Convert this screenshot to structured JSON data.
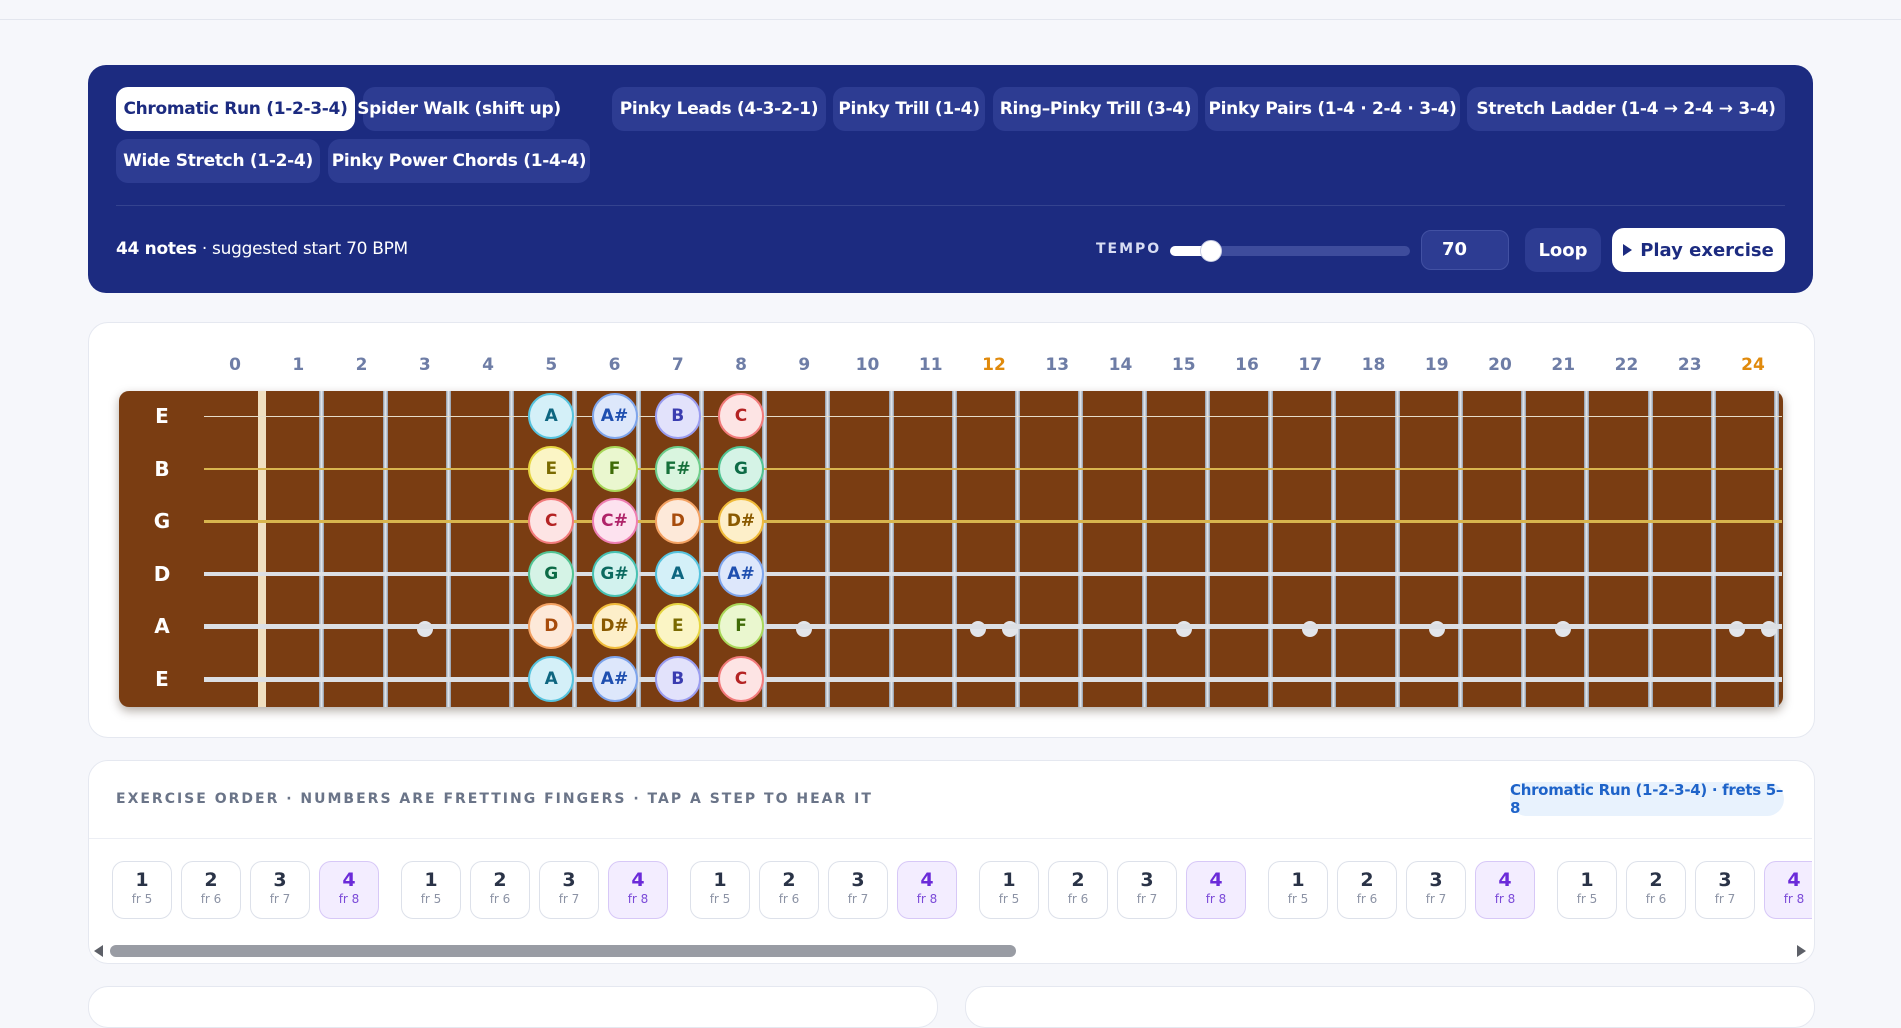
{
  "exercise_tabs": [
    {
      "label": "Chromatic Run (1-2-3-4)",
      "active": true
    },
    {
      "label": "Spider Walk (shift up)",
      "active": false
    },
    {
      "label": "Pinky Leads (4-3-2-1)",
      "active": false
    },
    {
      "label": "Pinky Trill (1-4)",
      "active": false
    },
    {
      "label": "Ring–Pinky Trill (3-4)",
      "active": false
    },
    {
      "label": "Pinky Pairs (1-4 · 2-4 · 3-4)",
      "active": false
    },
    {
      "label": "Stretch Ladder (1-4 → 2-4 → 3-4)",
      "active": false
    },
    {
      "label": "Wide Stretch (1-2-4)",
      "active": false
    },
    {
      "label": "Pinky Power Chords (1-4-4)",
      "active": false
    }
  ],
  "controls": {
    "note_count": "44 notes",
    "suggested": "· suggested start 70 BPM",
    "tempo_label": "TEMPO",
    "tempo_value": "70",
    "tempo_slider_fraction": 0.17,
    "loop_label": "Loop",
    "play_label": "Play exercise",
    "play_icon": "play-icon"
  },
  "fretboard": {
    "fret_numbers": [
      "0",
      "1",
      "2",
      "3",
      "4",
      "5",
      "6",
      "7",
      "8",
      "9",
      "10",
      "11",
      "12",
      "13",
      "14",
      "15",
      "16",
      "17",
      "18",
      "19",
      "20",
      "21",
      "22",
      "23",
      "24"
    ],
    "marker_frets": [
      "12",
      "24"
    ],
    "strings": [
      "E",
      "B",
      "G",
      "D",
      "A",
      "E"
    ],
    "inlay_frets": [
      "3",
      "5",
      "7",
      "9",
      "12",
      "15",
      "17",
      "19",
      "21",
      "24"
    ],
    "notes": [
      {
        "string": 0,
        "fret": 5,
        "name": "A"
      },
      {
        "string": 0,
        "fret": 6,
        "name": "A#"
      },
      {
        "string": 0,
        "fret": 7,
        "name": "B"
      },
      {
        "string": 0,
        "fret": 8,
        "name": "C"
      },
      {
        "string": 1,
        "fret": 5,
        "name": "E"
      },
      {
        "string": 1,
        "fret": 6,
        "name": "F"
      },
      {
        "string": 1,
        "fret": 7,
        "name": "F#"
      },
      {
        "string": 1,
        "fret": 8,
        "name": "G"
      },
      {
        "string": 2,
        "fret": 5,
        "name": "C"
      },
      {
        "string": 2,
        "fret": 6,
        "name": "C#"
      },
      {
        "string": 2,
        "fret": 7,
        "name": "D"
      },
      {
        "string": 2,
        "fret": 8,
        "name": "D#"
      },
      {
        "string": 3,
        "fret": 5,
        "name": "G"
      },
      {
        "string": 3,
        "fret": 6,
        "name": "G#"
      },
      {
        "string": 3,
        "fret": 7,
        "name": "A"
      },
      {
        "string": 3,
        "fret": 8,
        "name": "A#"
      },
      {
        "string": 4,
        "fret": 5,
        "name": "D"
      },
      {
        "string": 4,
        "fret": 6,
        "name": "D#"
      },
      {
        "string": 4,
        "fret": 7,
        "name": "E"
      },
      {
        "string": 4,
        "fret": 8,
        "name": "F"
      },
      {
        "string": 5,
        "fret": 5,
        "name": "A"
      },
      {
        "string": 5,
        "fret": 6,
        "name": "A#"
      },
      {
        "string": 5,
        "fret": 7,
        "name": "B"
      },
      {
        "string": 5,
        "fret": 8,
        "name": "C"
      }
    ],
    "note_colors": {
      "C": {
        "bg": "#fde4e4",
        "border": "#f27b7b",
        "text": "#b42323"
      },
      "C#": {
        "bg": "#fde2ef",
        "border": "#ee7fb2",
        "text": "#b0246a"
      },
      "D": {
        "bg": "#fde9d9",
        "border": "#f4a263",
        "text": "#a84c0c"
      },
      "D#": {
        "bg": "#fdefc9",
        "border": "#f0bb3a",
        "text": "#8a5a00"
      },
      "E": {
        "bg": "#fbf5c5",
        "border": "#e6d541",
        "text": "#7a6a00"
      },
      "F": {
        "bg": "#eaf7cf",
        "border": "#a9d85a",
        "text": "#3f6b07"
      },
      "F#": {
        "bg": "#d9f5df",
        "border": "#6dcd8a",
        "text": "#16703a"
      },
      "G": {
        "bg": "#d5f3e6",
        "border": "#52c493",
        "text": "#0d6b46"
      },
      "G#": {
        "bg": "#d2f2ee",
        "border": "#47c2b2",
        "text": "#0c6a60"
      },
      "A": {
        "bg": "#d4f0f8",
        "border": "#56c3de",
        "text": "#0e6680"
      },
      "A#": {
        "bg": "#dde7fb",
        "border": "#7ea5ec",
        "text": "#1f4fb0"
      },
      "B": {
        "bg": "#e2e2fb",
        "border": "#9a9cf0",
        "text": "#3a3cb0"
      }
    }
  },
  "exercise_order": {
    "title": "EXERCISE ORDER · NUMBERS ARE FRETTING FINGERS · TAP A STEP TO HEAR IT",
    "badge": "Chromatic Run (1-2-3-4) · frets 5–8",
    "steps": [
      {
        "finger": "1",
        "fret": "fr 5"
      },
      {
        "finger": "2",
        "fret": "fr 6"
      },
      {
        "finger": "3",
        "fret": "fr 7"
      },
      {
        "finger": "4",
        "fret": "fr 8"
      },
      {
        "finger": "1",
        "fret": "fr 5"
      },
      {
        "finger": "2",
        "fret": "fr 6"
      },
      {
        "finger": "3",
        "fret": "fr 7"
      },
      {
        "finger": "4",
        "fret": "fr 8"
      },
      {
        "finger": "1",
        "fret": "fr 5"
      },
      {
        "finger": "2",
        "fret": "fr 6"
      },
      {
        "finger": "3",
        "fret": "fr 7"
      },
      {
        "finger": "4",
        "fret": "fr 8"
      },
      {
        "finger": "1",
        "fret": "fr 5"
      },
      {
        "finger": "2",
        "fret": "fr 6"
      },
      {
        "finger": "3",
        "fret": "fr 7"
      },
      {
        "finger": "4",
        "fret": "fr 8"
      },
      {
        "finger": "1",
        "fret": "fr 5"
      },
      {
        "finger": "2",
        "fret": "fr 6"
      },
      {
        "finger": "3",
        "fret": "fr 7"
      },
      {
        "finger": "4",
        "fret": "fr 8"
      },
      {
        "finger": "1",
        "fret": "fr 5"
      },
      {
        "finger": "2",
        "fret": "fr 6"
      },
      {
        "finger": "3",
        "fret": "fr 7"
      },
      {
        "finger": "4",
        "fret": "fr 8"
      }
    ]
  }
}
